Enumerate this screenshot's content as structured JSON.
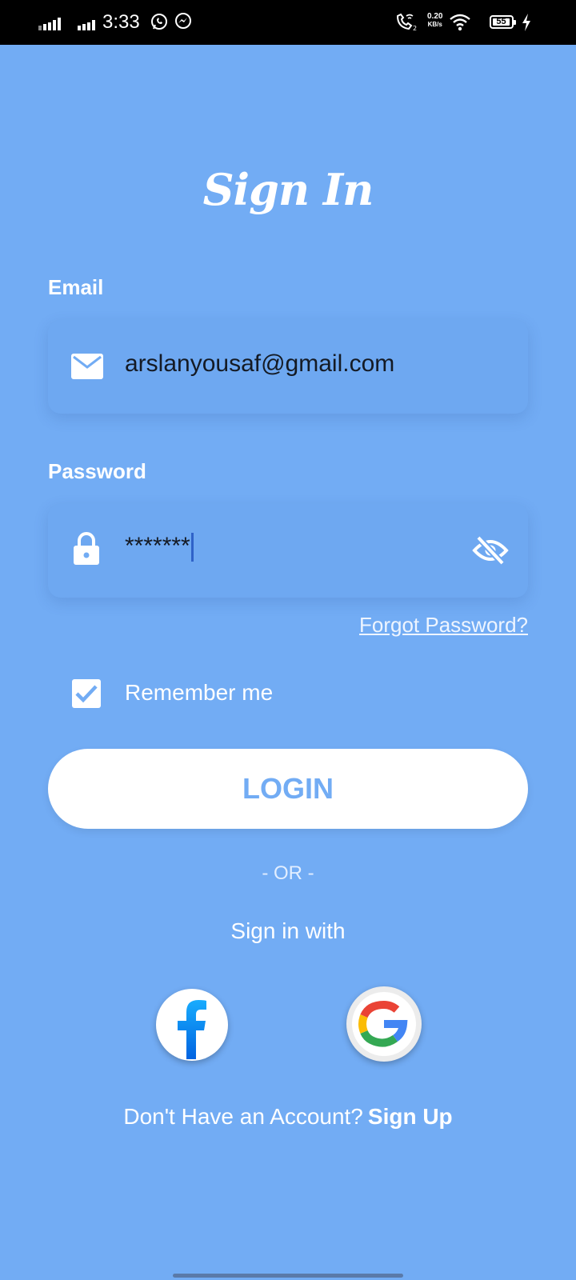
{
  "status_bar": {
    "time": "3:33",
    "net_speed_value": "0.20",
    "net_speed_unit": "KB/s",
    "battery": "55",
    "icons": [
      "signal-icon",
      "signal-icon",
      "whatsapp-icon",
      "messenger-icon",
      "volte-wifi-call-icon",
      "wifi-icon",
      "battery-icon",
      "charging-icon"
    ]
  },
  "screen": {
    "title": "Sign In",
    "background": "#72acf4"
  },
  "email": {
    "label": "Email",
    "value": "arslanyousaf@gmail.com",
    "icon": "mail-icon"
  },
  "password": {
    "label": "Password",
    "value": "*******",
    "icon": "lock-icon",
    "toggle_icon": "eye-off-icon"
  },
  "forgot_password": "Forgot Password?",
  "remember_me": {
    "label": "Remember me",
    "checked": true
  },
  "login_button": "LOGIN",
  "divider_text": "- OR -",
  "social": {
    "heading": "Sign in with",
    "providers": [
      "facebook",
      "google"
    ]
  },
  "footer": {
    "prompt": "Don't Have an Account?",
    "link": "Sign Up"
  }
}
